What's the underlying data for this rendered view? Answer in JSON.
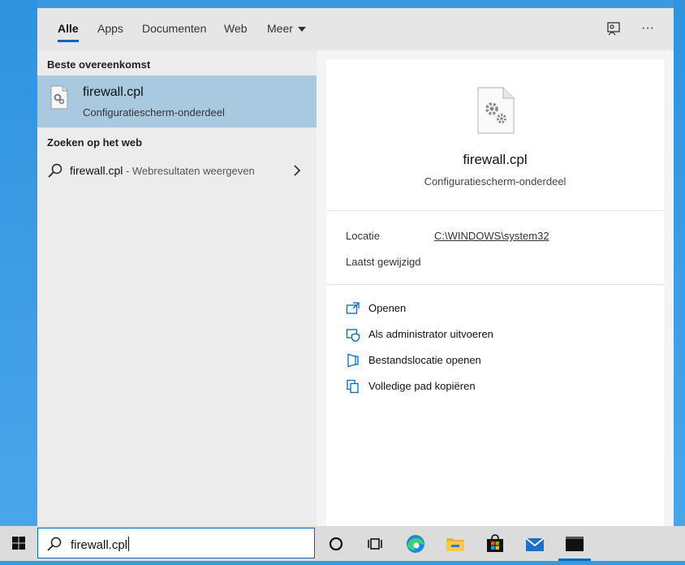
{
  "tabs": [
    {
      "label": "Alle",
      "active": true
    },
    {
      "label": "Apps"
    },
    {
      "label": "Documenten"
    },
    {
      "label": "Web"
    },
    {
      "label": "Meer"
    }
  ],
  "toolbar_icons": [
    "feedback-icon",
    "more-options-icon"
  ],
  "more_icon_glyph": "···",
  "results": {
    "best_match_header": "Beste overeenkomst",
    "best_match": {
      "title": "firewall.cpl",
      "subtitle": "Configuratiescherm-onderdeel"
    },
    "web_header": "Zoeken op het web",
    "web_result": {
      "query": "firewall.cpl",
      "suffix": " - Webresultaten weergeven"
    }
  },
  "preview": {
    "title": "firewall.cpl",
    "subtitle": "Configuratiescherm-onderdeel",
    "location_label": "Locatie",
    "location_value": "C:\\WINDOWS\\system32",
    "modified_label": "Laatst gewijzigd",
    "actions": [
      {
        "label": "Openen",
        "icon": "open-icon"
      },
      {
        "label": "Als administrator uitvoeren",
        "icon": "shield-icon"
      },
      {
        "label": "Bestandslocatie openen",
        "icon": "folder-location-icon"
      },
      {
        "label": "Volledige pad kopiëren",
        "icon": "copy-icon"
      }
    ]
  },
  "taskbar": {
    "search_value": "firewall.cpl",
    "icons": [
      "windows-start-icon",
      "cortana-icon",
      "task-view-icon",
      "edge-icon",
      "file-explorer-icon",
      "store-icon",
      "mail-icon",
      "terminal-icon"
    ]
  },
  "colors": {
    "accent": "#0067c0",
    "selected": "#a9c9e1",
    "desktop": "#3a9ae0"
  }
}
